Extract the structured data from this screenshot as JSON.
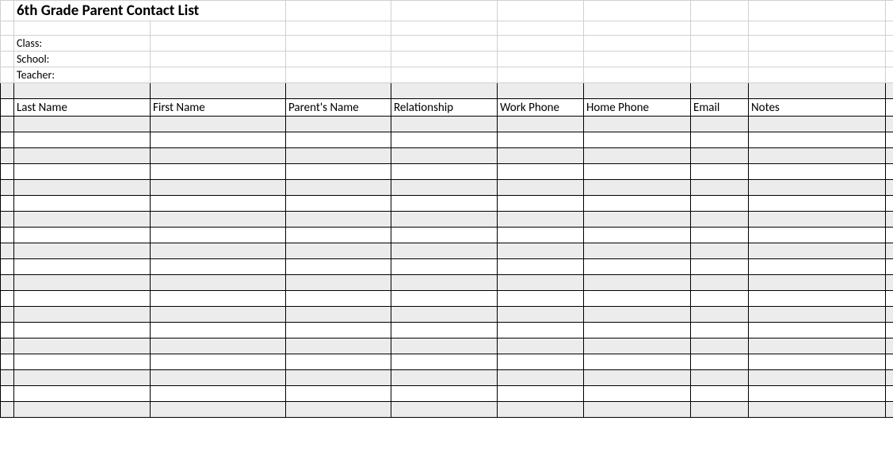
{
  "title": "6th Grade Parent Contact List",
  "meta": {
    "class_label": "Class:",
    "school_label": "School:",
    "teacher_label": "Teacher:"
  },
  "columns": {
    "last_name": "Last Name",
    "first_name": "First Name",
    "parents_name": "Parent's Name",
    "relationship": "Relationship",
    "work_phone": "Work Phone",
    "home_phone": "Home Phone",
    "email": "Email",
    "notes": "Notes"
  },
  "rows": [
    {
      "last_name": "",
      "first_name": "",
      "parents_name": "",
      "relationship": "",
      "work_phone": "",
      "home_phone": "",
      "email": "",
      "notes": ""
    },
    {
      "last_name": "",
      "first_name": "",
      "parents_name": "",
      "relationship": "",
      "work_phone": "",
      "home_phone": "",
      "email": "",
      "notes": ""
    },
    {
      "last_name": "",
      "first_name": "",
      "parents_name": "",
      "relationship": "",
      "work_phone": "",
      "home_phone": "",
      "email": "",
      "notes": ""
    },
    {
      "last_name": "",
      "first_name": "",
      "parents_name": "",
      "relationship": "",
      "work_phone": "",
      "home_phone": "",
      "email": "",
      "notes": ""
    },
    {
      "last_name": "",
      "first_name": "",
      "parents_name": "",
      "relationship": "",
      "work_phone": "",
      "home_phone": "",
      "email": "",
      "notes": ""
    },
    {
      "last_name": "",
      "first_name": "",
      "parents_name": "",
      "relationship": "",
      "work_phone": "",
      "home_phone": "",
      "email": "",
      "notes": ""
    },
    {
      "last_name": "",
      "first_name": "",
      "parents_name": "",
      "relationship": "",
      "work_phone": "",
      "home_phone": "",
      "email": "",
      "notes": ""
    },
    {
      "last_name": "",
      "first_name": "",
      "parents_name": "",
      "relationship": "",
      "work_phone": "",
      "home_phone": "",
      "email": "",
      "notes": ""
    },
    {
      "last_name": "",
      "first_name": "",
      "parents_name": "",
      "relationship": "",
      "work_phone": "",
      "home_phone": "",
      "email": "",
      "notes": ""
    },
    {
      "last_name": "",
      "first_name": "",
      "parents_name": "",
      "relationship": "",
      "work_phone": "",
      "home_phone": "",
      "email": "",
      "notes": ""
    },
    {
      "last_name": "",
      "first_name": "",
      "parents_name": "",
      "relationship": "",
      "work_phone": "",
      "home_phone": "",
      "email": "",
      "notes": ""
    },
    {
      "last_name": "",
      "first_name": "",
      "parents_name": "",
      "relationship": "",
      "work_phone": "",
      "home_phone": "",
      "email": "",
      "notes": ""
    },
    {
      "last_name": "",
      "first_name": "",
      "parents_name": "",
      "relationship": "",
      "work_phone": "",
      "home_phone": "",
      "email": "",
      "notes": ""
    },
    {
      "last_name": "",
      "first_name": "",
      "parents_name": "",
      "relationship": "",
      "work_phone": "",
      "home_phone": "",
      "email": "",
      "notes": ""
    },
    {
      "last_name": "",
      "first_name": "",
      "parents_name": "",
      "relationship": "",
      "work_phone": "",
      "home_phone": "",
      "email": "",
      "notes": ""
    },
    {
      "last_name": "",
      "first_name": "",
      "parents_name": "",
      "relationship": "",
      "work_phone": "",
      "home_phone": "",
      "email": "",
      "notes": ""
    },
    {
      "last_name": "",
      "first_name": "",
      "parents_name": "",
      "relationship": "",
      "work_phone": "",
      "home_phone": "",
      "email": "",
      "notes": ""
    },
    {
      "last_name": "",
      "first_name": "",
      "parents_name": "",
      "relationship": "",
      "work_phone": "",
      "home_phone": "",
      "email": "",
      "notes": ""
    }
  ]
}
